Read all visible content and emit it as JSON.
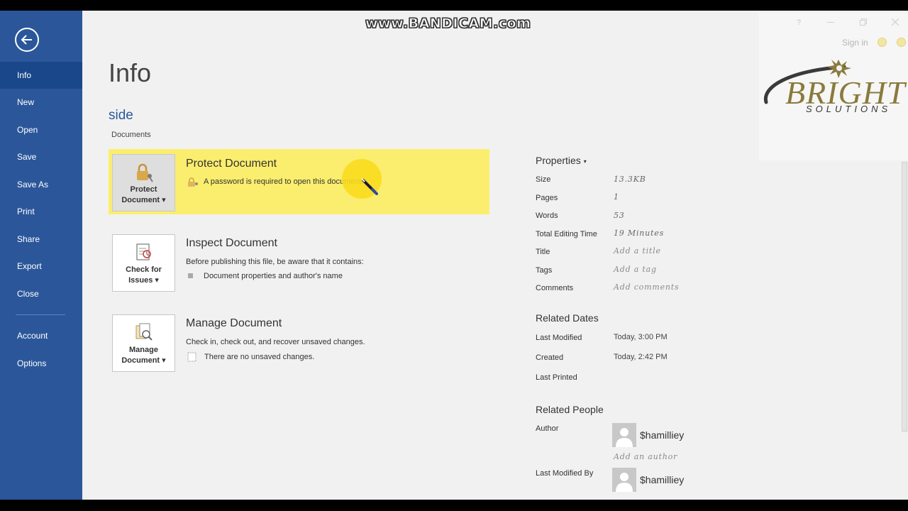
{
  "watermark": "www.BANDICAM.com",
  "sidebar": {
    "items": [
      {
        "label": "Info"
      },
      {
        "label": "New"
      },
      {
        "label": "Open"
      },
      {
        "label": "Save"
      },
      {
        "label": "Save As"
      },
      {
        "label": "Print"
      },
      {
        "label": "Share"
      },
      {
        "label": "Export"
      },
      {
        "label": "Close"
      },
      {
        "label": "Account"
      },
      {
        "label": "Options"
      }
    ],
    "active": "Info",
    "background": "#2b579a",
    "active_background": "#19478a"
  },
  "main": {
    "title": "Info",
    "doc_name": "side",
    "doc_location": "Documents",
    "sections": [
      {
        "button": "Protect Document",
        "title": "Protect Document",
        "description": "",
        "detail": "A password is required to open this document.",
        "highlighted": true,
        "icon": "lock-key-icon"
      },
      {
        "button": "Check for Issues",
        "title": "Inspect Document",
        "description": "Before publishing this file, be aware that it contains:",
        "detail": "Document properties and author's name",
        "icon": "inspect-document-icon"
      },
      {
        "button": "Manage Document",
        "title": "Manage Document",
        "description": "Check in, check out, and recover unsaved changes.",
        "detail": "There are no unsaved changes.",
        "icon": "manage-document-icon"
      }
    ]
  },
  "properties": {
    "heading": "Properties",
    "rows": [
      {
        "key": "Size",
        "value": "13.3KB"
      },
      {
        "key": "Pages",
        "value": "1"
      },
      {
        "key": "Words",
        "value": "53"
      },
      {
        "key": "Total Editing Time",
        "value": "19 Minutes"
      },
      {
        "key": "Title",
        "value": "Add a title"
      },
      {
        "key": "Tags",
        "value": "Add a tag"
      },
      {
        "key": "Comments",
        "value": "Add comments"
      }
    ]
  },
  "related_dates": {
    "heading": "Related Dates",
    "rows": [
      {
        "key": "Last Modified",
        "value": "Today, 3:00 PM"
      },
      {
        "key": "Created",
        "value": "Today, 2:42 PM"
      },
      {
        "key": "Last Printed",
        "value": ""
      }
    ]
  },
  "related_people": {
    "heading": "Related People",
    "author_label": "Author",
    "author": "$hamilliey",
    "add_author": "Add an author",
    "last_modified_by_label": "Last Modified By",
    "last_modified_by": "$hamilliey"
  },
  "window": {
    "help": "?",
    "sign_in": "Sign in"
  },
  "logo": {
    "text": "BRIGHT",
    "subtext": "SOLUTIONS"
  },
  "colors": {
    "accent": "#2b579a",
    "highlight": "#fbee6e",
    "logo": "#8a7a3c"
  }
}
